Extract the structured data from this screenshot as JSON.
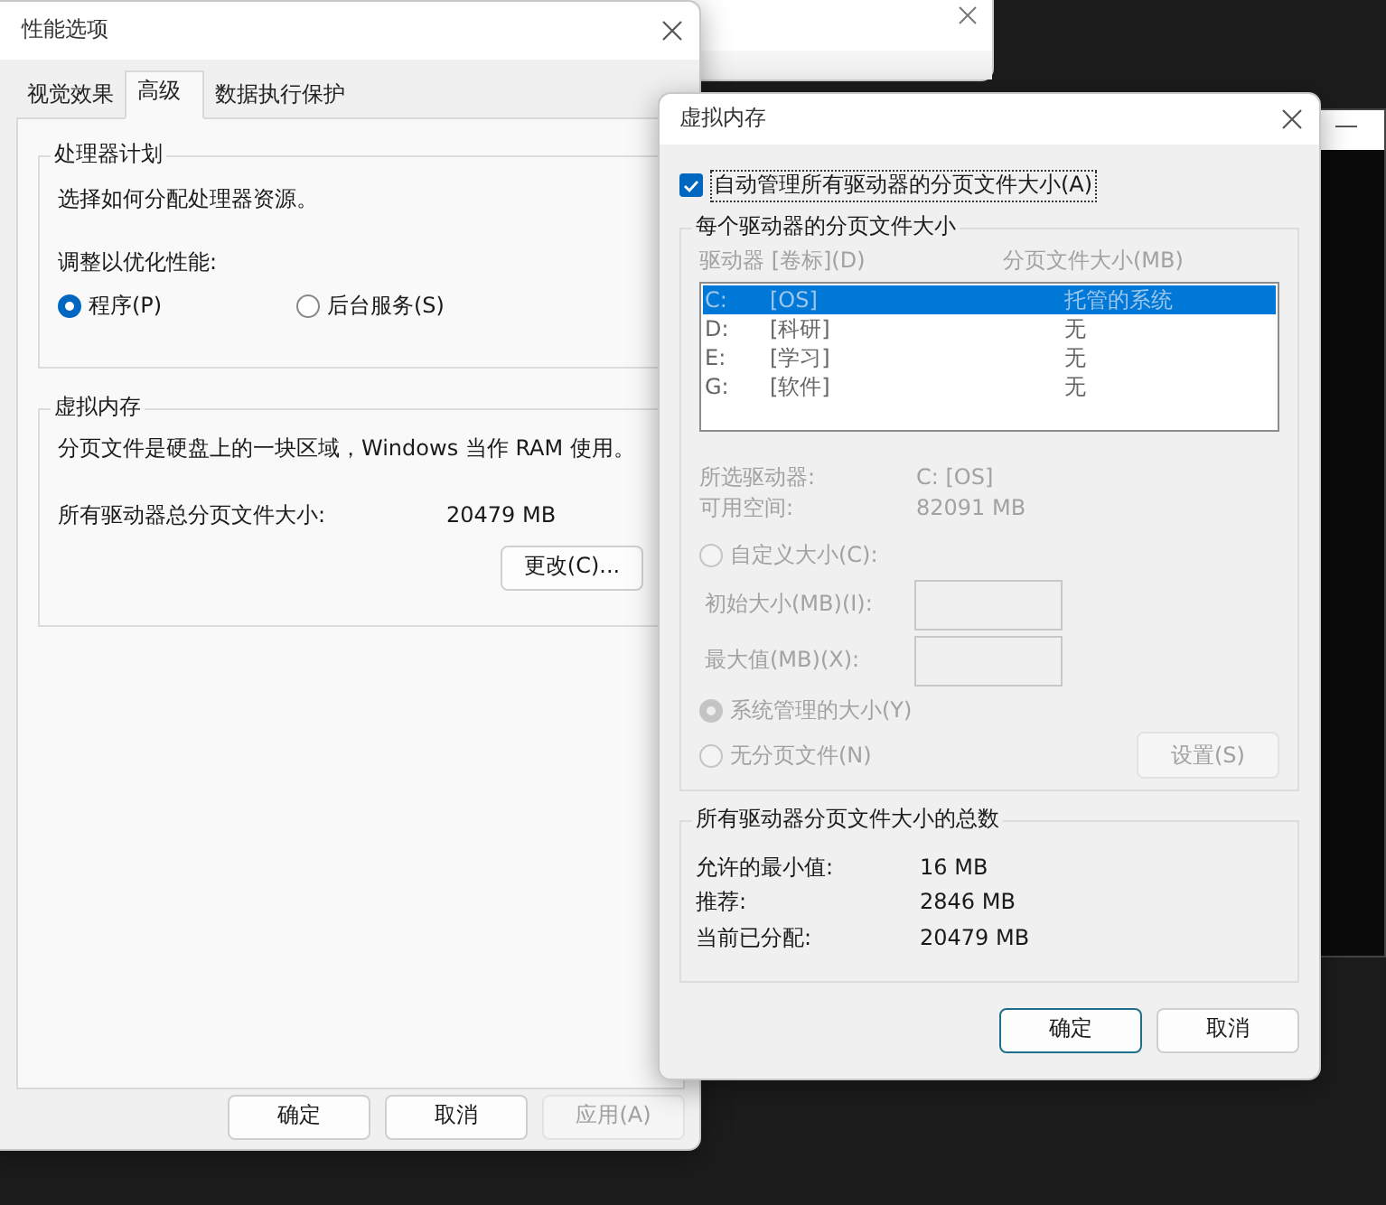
{
  "performance_options": {
    "title": "性能选项",
    "tabs": [
      {
        "label": "视觉效果",
        "selected": false
      },
      {
        "label": "高级",
        "selected": true
      },
      {
        "label": "数据执行保护",
        "selected": false
      }
    ],
    "processor_group": {
      "title": "处理器计划",
      "description": "选择如何分配处理器资源。",
      "adjust_label": "调整以优化性能:",
      "options": [
        {
          "label": "程序(P)",
          "selected": true
        },
        {
          "label": "后台服务(S)",
          "selected": false
        }
      ]
    },
    "virtual_memory_group": {
      "title": "虚拟内存",
      "description": "分页文件是硬盘上的一块区域，Windows 当作 RAM 使用。",
      "total_label": "所有驱动器总分页文件大小:",
      "total_value": "20479 MB",
      "change_button": "更改(C)..."
    },
    "buttons": [
      {
        "label": "确定",
        "disabled": false
      },
      {
        "label": "取消",
        "disabled": false
      },
      {
        "label": "应用(A)",
        "disabled": true
      }
    ]
  },
  "virtual_memory_dialog": {
    "title": "虚拟内存",
    "auto_manage": {
      "label": "自动管理所有驱动器的分页文件大小(A)",
      "checked": true
    },
    "drives_group": {
      "title": "每个驱动器的分页文件大小",
      "disabled": true,
      "columns": [
        "驱动器 [卷标](D)",
        "分页文件大小(MB)"
      ],
      "rows": [
        {
          "drive": "C:",
          "volume": "[OS]",
          "size": "托管的系统",
          "selected": true
        },
        {
          "drive": "D:",
          "volume": "[科研]",
          "size": "无",
          "selected": false
        },
        {
          "drive": "E:",
          "volume": "[学习]",
          "size": "无",
          "selected": false
        },
        {
          "drive": "G:",
          "volume": "[软件]",
          "size": "无",
          "selected": false
        }
      ],
      "selected_drive_label": "所选驱动器:",
      "selected_drive_value": "C: [OS]",
      "free_space_label": "可用空间:",
      "free_space_value": "82091 MB",
      "size_options": [
        {
          "kind": "custom",
          "label": "自定义大小(C):",
          "selected": false
        },
        {
          "kind": "plain",
          "label": "系统管理的大小(Y)",
          "selected": true
        },
        {
          "kind": "set",
          "label": "无分页文件(N)",
          "selected": false
        }
      ],
      "custom_fields": [
        {
          "label": "初始大小(MB)(I):"
        },
        {
          "label": "最大值(MB)(X):"
        }
      ],
      "set_button": "设置(S)"
    },
    "totals_group": {
      "title": "所有驱动器分页文件大小的总数",
      "rows": [
        {
          "label": "允许的最小值:",
          "value": "16 MB"
        },
        {
          "label": "推荐:",
          "value": "2846 MB"
        },
        {
          "label": "当前已分配:",
          "value": "20479 MB"
        }
      ]
    },
    "buttons": [
      {
        "label": "确定",
        "default": true
      },
      {
        "label": "取消",
        "default": false
      }
    ]
  }
}
